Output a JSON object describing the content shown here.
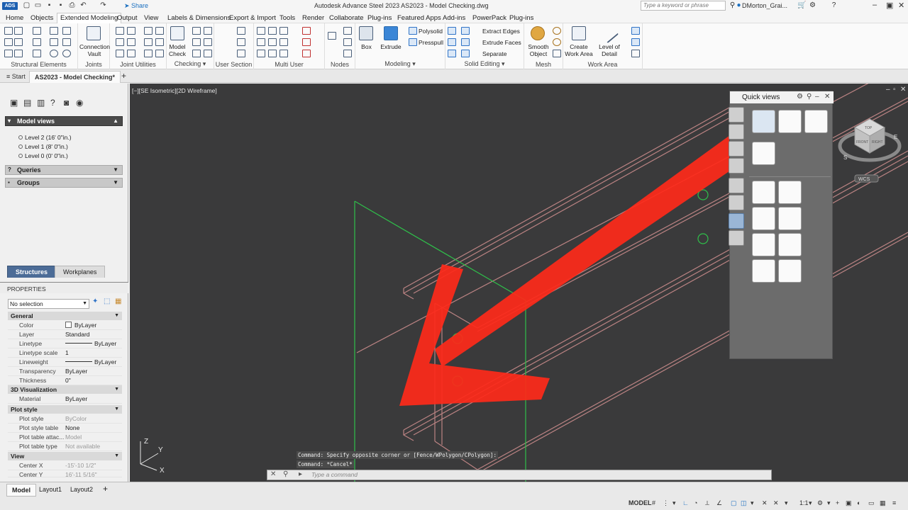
{
  "title_bar": {
    "app_badge": "ADS",
    "share_label": "Share",
    "title": "Autodesk Advance Steel 2023    AS2023 - Model Checking.dwg",
    "search_placeholder": "Type a keyword or phrase",
    "user": "DMorton_Grai..."
  },
  "menu_tabs": [
    "Home",
    "Objects",
    "Extended Modeling",
    "Output",
    "View",
    "Labels & Dimensions",
    "Export & Import",
    "Tools",
    "Render",
    "Collaborate",
    "Plug-ins",
    "Featured Apps",
    "Add-ins",
    "PowerPack",
    "Plug-ins"
  ],
  "ribbon": {
    "panels": {
      "structural_elements": "Structural Elements",
      "joints": "Joints",
      "joint_utilities": "Joint Utilities",
      "checking": "Checking",
      "user_section": "User Section",
      "multi_user": "Multi User",
      "nodes": "Nodes",
      "modeling": "Modeling",
      "solid_editing": "Solid Editing",
      "mesh": "Mesh",
      "work_area": "Work Area"
    },
    "buttons": {
      "connection_vault": "Connection\nVault",
      "model_check": "Model\nCheck",
      "box": "Box",
      "extrude": "Extrude",
      "polysolid": "Polysolid",
      "presspull": "Presspull",
      "extract_edges": "Extract Edges",
      "extrude_faces": "Extrude Faces",
      "separate": "Separate",
      "smooth_object": "Smooth\nObject",
      "create_work_area": "Create\nWork Area",
      "level_of_detail": "Level of\nDetail"
    }
  },
  "doc_tabs": {
    "start": "Start",
    "active": "AS2023 - Model Checking*",
    "add": "+"
  },
  "left_panel": {
    "model_views_header": "Model views",
    "levels": [
      "Level 2 (16' 0\"in.)",
      "Level 1 (8' 0\"in.)",
      "Level 0 (0' 0\"in.)"
    ],
    "queries_header": "Queries",
    "groups_header": "Groups",
    "tabs": [
      "Structures",
      "Workplanes"
    ],
    "properties_header": "PROPERTIES",
    "selection": "No selection",
    "sections": {
      "general": "General",
      "viz3d": "3D Visualization",
      "plot_style": "Plot style",
      "view": "View"
    },
    "general_rows": [
      {
        "k": "Color",
        "v": "ByLayer"
      },
      {
        "k": "Layer",
        "v": "Standard"
      },
      {
        "k": "Linetype",
        "v": "ByLayer"
      },
      {
        "k": "Linetype scale",
        "v": "1"
      },
      {
        "k": "Lineweight",
        "v": "ByLayer"
      },
      {
        "k": "Transparency",
        "v": "ByLayer"
      },
      {
        "k": "Thickness",
        "v": "0\""
      }
    ],
    "viz_rows": [
      {
        "k": "Material",
        "v": "ByLayer"
      }
    ],
    "plot_rows": [
      {
        "k": "Plot style",
        "v": "ByColor"
      },
      {
        "k": "Plot style table",
        "v": "None"
      },
      {
        "k": "Plot table attac...",
        "v": "Model"
      },
      {
        "k": "Plot table type",
        "v": "Not available"
      }
    ],
    "view_rows": [
      {
        "k": "Center X",
        "v": "-15'-10 1/2\""
      },
      {
        "k": "Center Y",
        "v": "16'-11 5/16\""
      }
    ]
  },
  "viewport": {
    "label": "[−][SE Isometric][2D Wireframe]",
    "bg_color": "#3a3a3b",
    "accent_red": "#ff2a1a",
    "cube_labels": {
      "top": "TOP",
      "front": "FRONT",
      "right": "RIGHT",
      "wcs": "WCS",
      "s": "S",
      "e": "E"
    }
  },
  "quick_views": {
    "title": "Quick views"
  },
  "command": {
    "line1": "Command: Specify opposite corner or [Fence/WPolygon/CPolygon]:",
    "line2": "Command: *Cancel*",
    "placeholder": "Type a command"
  },
  "layout_tabs": [
    "Model",
    "Layout1",
    "Layout2",
    "+"
  ],
  "status": {
    "model": "MODEL",
    "scale": "1:1"
  }
}
